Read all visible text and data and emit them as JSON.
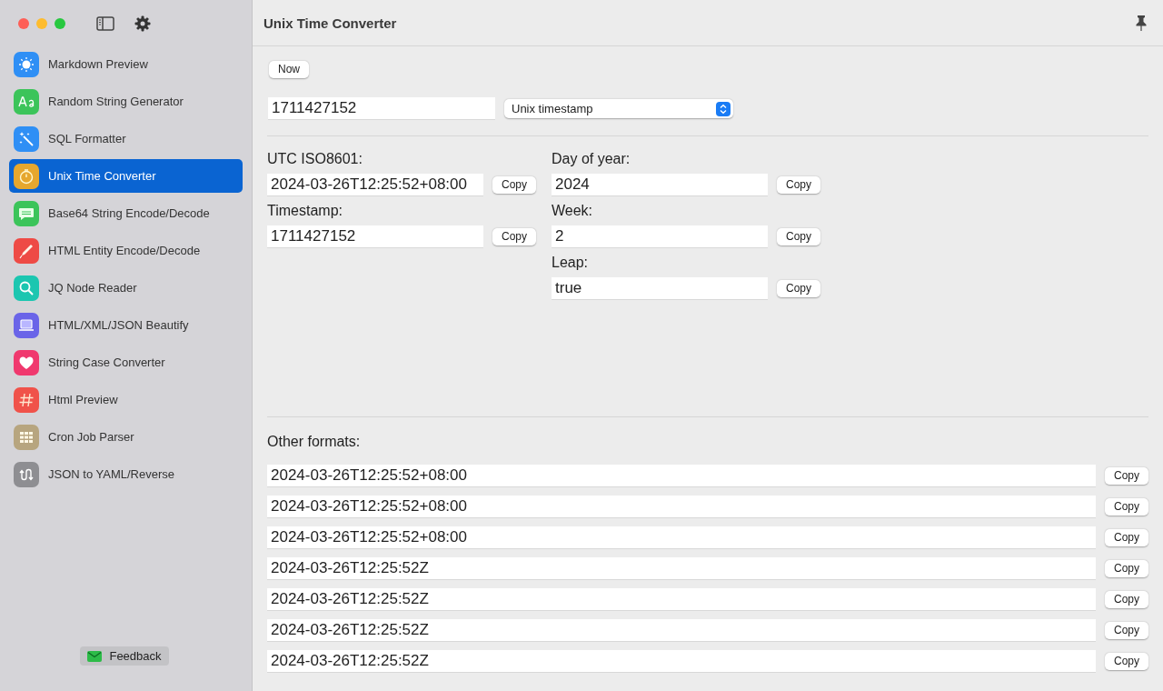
{
  "sidebar": {
    "items": [
      {
        "label": "Markdown Preview",
        "kind": "sun",
        "color": "#2f8ff5",
        "selected": false
      },
      {
        "label": "Random String Generator",
        "kind": "letters",
        "color": "#3cc45a",
        "selected": false
      },
      {
        "label": "SQL Formatter",
        "kind": "wand",
        "color": "#2f8ff5",
        "selected": false
      },
      {
        "label": "Unix Time Converter",
        "kind": "timer",
        "color": "#e6a72e",
        "selected": true
      },
      {
        "label": "Base64 String Encode/Decode",
        "kind": "chat",
        "color": "#3cc45a",
        "selected": false
      },
      {
        "label": "HTML Entity Encode/Decode",
        "kind": "pen",
        "color": "#ee4a45",
        "selected": false
      },
      {
        "label": "JQ Node Reader",
        "kind": "search",
        "color": "#1cc6b0",
        "selected": false
      },
      {
        "label": "HTML/XML/JSON Beautify",
        "kind": "laptop",
        "color": "#6a64e8",
        "selected": false
      },
      {
        "label": "String Case Converter",
        "kind": "heart",
        "color": "#f0386e",
        "selected": false
      },
      {
        "label": "Html Preview",
        "kind": "hash",
        "color": "#f0524a",
        "selected": false
      },
      {
        "label": "Cron Job Parser",
        "kind": "grid",
        "color": "#b7a57f",
        "selected": false
      },
      {
        "label": "JSON to YAML/Reverse",
        "kind": "arrows",
        "color": "#8e8e92",
        "selected": false
      }
    ],
    "feedback": "Feedback"
  },
  "header": {
    "title": "Unix Time Converter"
  },
  "now_button": "Now",
  "input": {
    "value": "1711427152",
    "format": "Unix timestamp"
  },
  "left_fields": [
    {
      "label": "UTC ISO8601:",
      "value": "2024-03-26T12:25:52+08:00",
      "button": "Copy"
    },
    {
      "label": "Timestamp:",
      "value": "1711427152",
      "button": "Copy"
    }
  ],
  "right_fields": [
    {
      "label": "Day of year:",
      "value": "2024",
      "button": "Copy"
    },
    {
      "label": "Week:",
      "value": "2",
      "button": "Copy"
    },
    {
      "label": "Leap:",
      "value": "true",
      "button": "Copy"
    }
  ],
  "other_formats": {
    "label": "Other formats:",
    "rows": [
      {
        "value": "2024-03-26T12:25:52+08:00",
        "button": "Copy"
      },
      {
        "value": "2024-03-26T12:25:52+08:00",
        "button": "Copy"
      },
      {
        "value": "2024-03-26T12:25:52+08:00",
        "button": "Copy"
      },
      {
        "value": "2024-03-26T12:25:52Z",
        "button": "Copy"
      },
      {
        "value": "2024-03-26T12:25:52Z",
        "button": "Copy"
      },
      {
        "value": "2024-03-26T12:25:52Z",
        "button": "Copy"
      },
      {
        "value": "2024-03-26T12:25:52Z",
        "button": "Copy"
      }
    ]
  }
}
